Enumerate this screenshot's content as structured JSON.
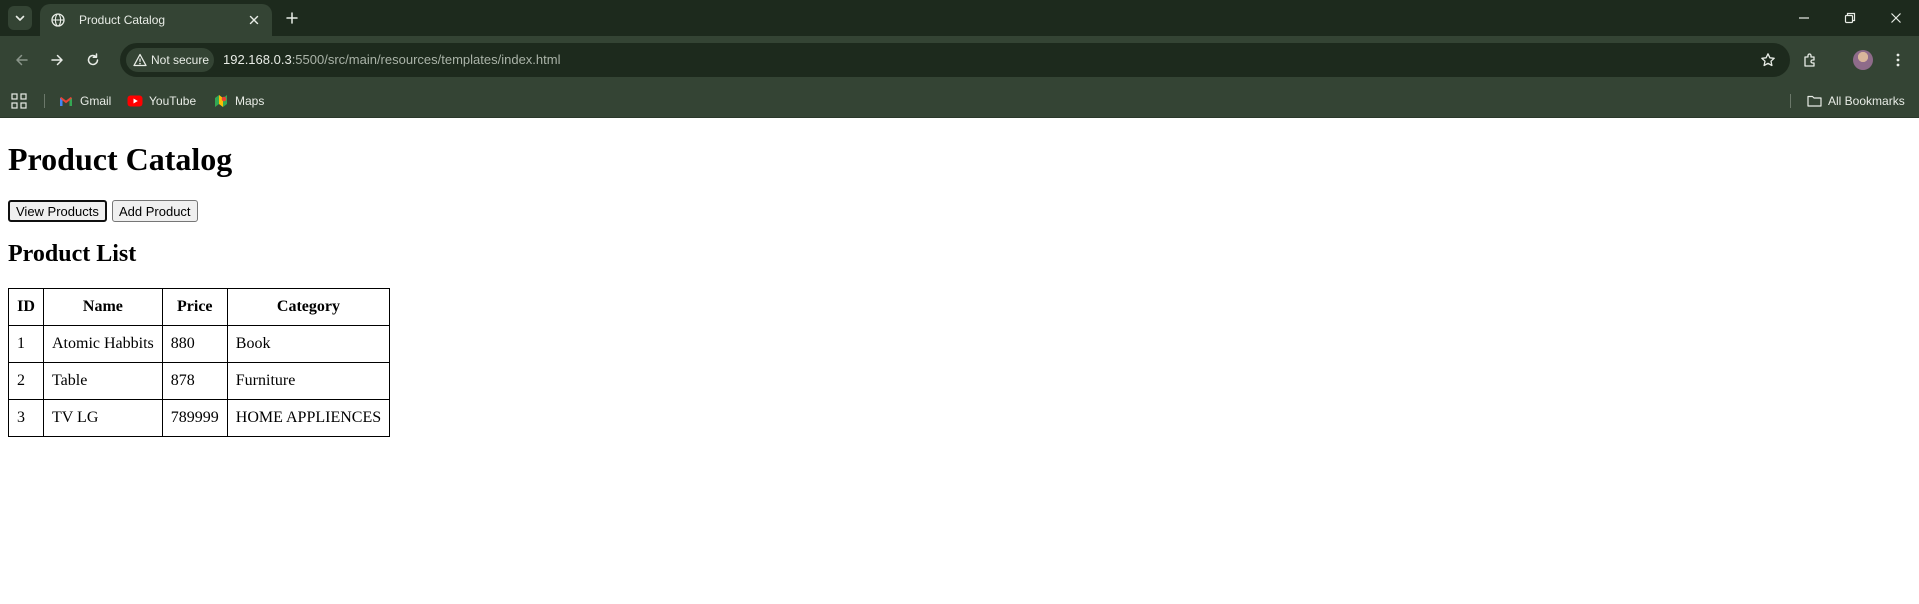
{
  "browser": {
    "tab": {
      "title": "Product Catalog"
    },
    "omnibox": {
      "security_label": "Not secure",
      "url_host": "192.168.0.3",
      "url_path": ":5500/src/main/resources/templates/index.html"
    },
    "bookmarks": [
      {
        "label": "Gmail",
        "icon": "gmail-icon"
      },
      {
        "label": "YouTube",
        "icon": "youtube-icon"
      },
      {
        "label": "Maps",
        "icon": "maps-icon"
      }
    ],
    "all_bookmarks_label": "All Bookmarks",
    "colors": {
      "titlebar": "#1d2a1d",
      "toolbar": "#344434",
      "text": "#e8ece6"
    }
  },
  "page": {
    "title": "Product Catalog",
    "buttons": {
      "view_products": "View Products",
      "add_product": "Add Product"
    },
    "section_title": "Product List",
    "table": {
      "headers": [
        "ID",
        "Name",
        "Price",
        "Category"
      ],
      "rows": [
        [
          "1",
          "Atomic Habbits",
          "880",
          "Book"
        ],
        [
          "2",
          "Table",
          "878",
          "Furniture"
        ],
        [
          "3",
          "TV LG",
          "789999",
          "HOME APPLIENCES"
        ]
      ]
    }
  }
}
